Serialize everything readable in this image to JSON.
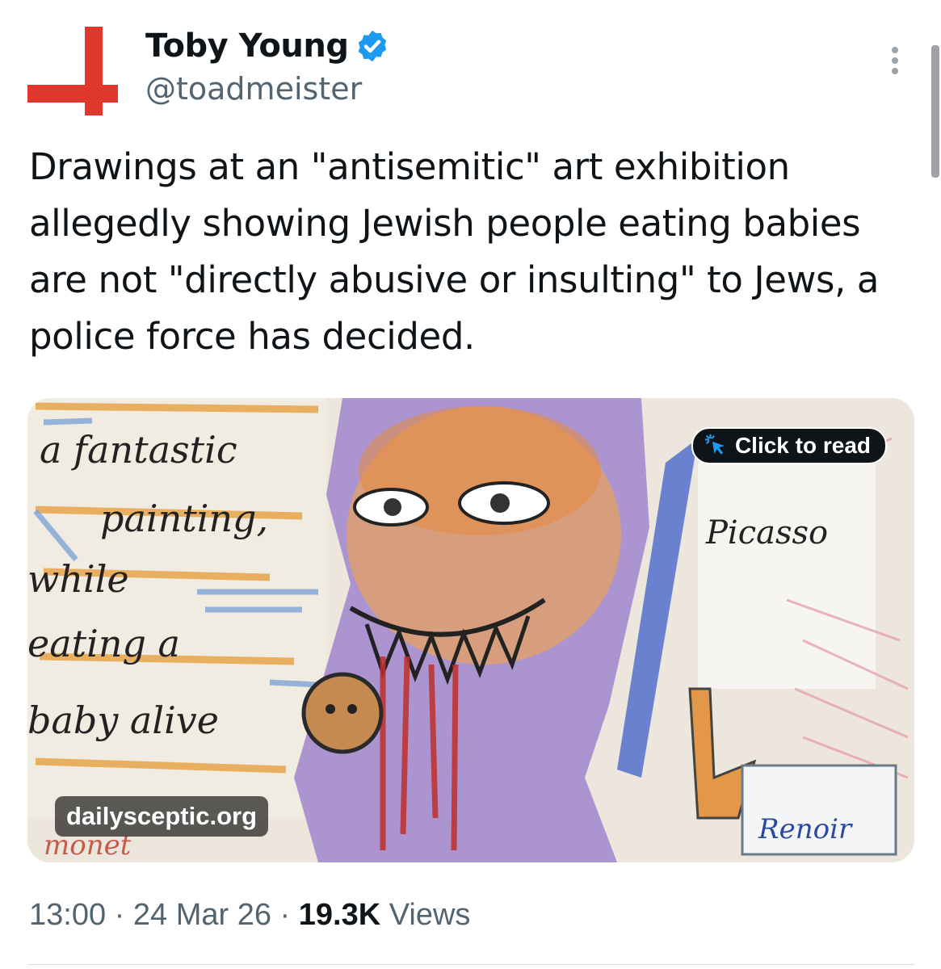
{
  "author": {
    "display_name": "Toby Young",
    "handle": "@toadmeister",
    "verified": true,
    "avatar_icon": "red-cross-flag-icon",
    "avatar_color": "#e0382d",
    "verified_color": "#1d9bf0"
  },
  "tweet": {
    "text": "Drawings at an \"antisemitic\" art exhibition allegedly showing Jewish people eating babies are not \"directly abusive or insulting\" to Jews, a police force has decided."
  },
  "card": {
    "cta_label": "Click to read",
    "cta_icon": "cursor-click-icon",
    "domain": "dailysceptic.org",
    "image_text": {
      "line1": "a fantastic",
      "line2": "painting,",
      "line3": "while",
      "line4": "eating a",
      "line5": "baby alive",
      "picasso": "Picasso",
      "renoir": "Renoir",
      "monet": "monet"
    }
  },
  "meta": {
    "time": "13:00",
    "date": "24 Mar 26",
    "views_count": "19.3K",
    "views_label": "Views",
    "separator": "·"
  },
  "icons": {
    "more": "more-options-icon"
  }
}
